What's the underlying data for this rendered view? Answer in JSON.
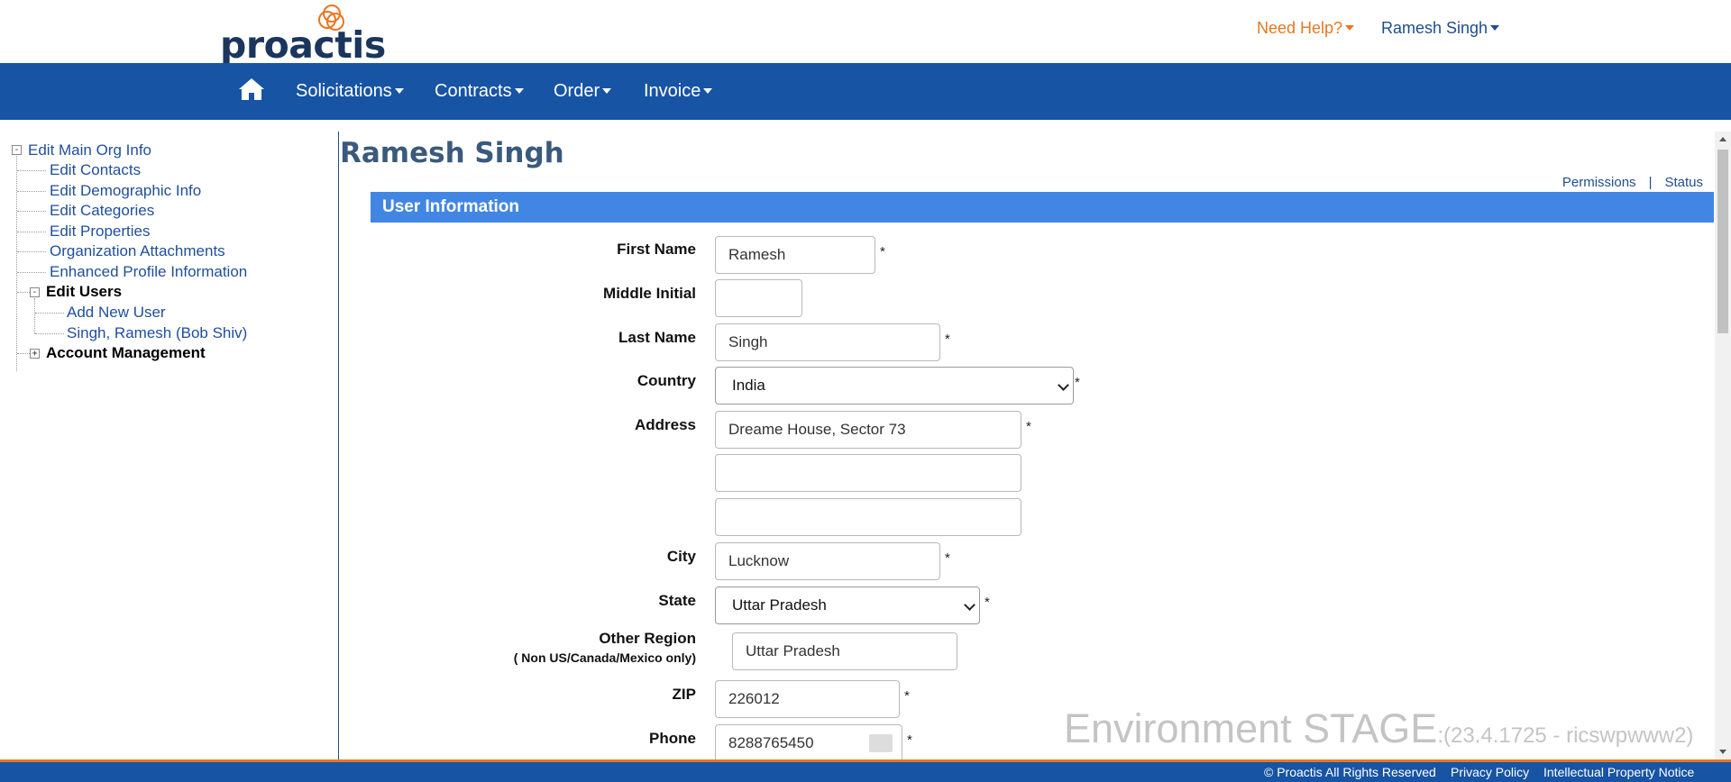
{
  "header": {
    "logo_text": "proactis",
    "help_label": "Need Help?",
    "user_name": "Ramesh Singh"
  },
  "nav": {
    "items": [
      "Solicitations",
      "Contracts",
      "Order",
      "Invoice"
    ]
  },
  "tree": {
    "root": "Edit Main Org Info",
    "items": [
      "Edit Contacts",
      "Edit Demographic Info",
      "Edit Categories",
      "Edit Properties",
      "Organization Attachments",
      "Enhanced Profile Information"
    ],
    "edit_users": "Edit Users",
    "users_children": [
      "Add New User",
      "Singh, Ramesh (Bob Shiv)"
    ],
    "account_management": "Account Management",
    "expand_toggle": "+",
    "collapse_toggle": "-"
  },
  "main": {
    "title": "Ramesh Singh",
    "links": {
      "permissions": "Permissions",
      "separator": "|",
      "status": "Status"
    },
    "section_title": "User Information",
    "required_mark": "*",
    "fields": {
      "first_name": {
        "label": "First Name",
        "value": "Ramesh"
      },
      "middle_initial": {
        "label": "Middle Initial",
        "value": ""
      },
      "last_name": {
        "label": "Last Name",
        "value": "Singh"
      },
      "country": {
        "label": "Country",
        "value": "India"
      },
      "address": {
        "label": "Address",
        "line1": "Dreame House, Sector 73",
        "line2": "",
        "line3": ""
      },
      "city": {
        "label": "City",
        "value": "Lucknow"
      },
      "state": {
        "label": "State",
        "value": "Uttar Pradesh"
      },
      "other_region": {
        "label": "Other Region",
        "sublabel": "( Non US/Canada/Mexico only)",
        "value": "Uttar Pradesh"
      },
      "zip": {
        "label": "ZIP",
        "value": "226012"
      },
      "phone": {
        "label": "Phone",
        "value": "8288765450"
      }
    }
  },
  "environment": {
    "label": "Environment STAGE",
    "version": ":(23.4.1725 - ricswpwww2)"
  },
  "footer": {
    "copyright": "© Proactis All Rights Reserved",
    "privacy": "Privacy Policy",
    "ip_notice": "Intellectual Property Notice"
  },
  "colors": {
    "brand_blue": "#1754a4",
    "section_blue": "#4286e4",
    "accent_orange": "#e87722",
    "logo_navy": "#1b365d",
    "link_blue": "#1f4e9c"
  },
  "icons": {
    "home": "home-icon",
    "caret": "caret-down-icon",
    "logo_mark": "proactis-rings-logo"
  }
}
